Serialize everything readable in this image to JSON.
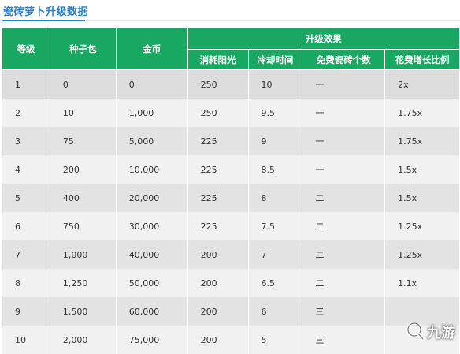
{
  "title": "瓷砖萝卜升级数据",
  "headers": {
    "level": "等级",
    "seed_pack": "种子包",
    "gold": "金币",
    "upgrade_effect": "升级效果",
    "sun_cost": "消耗阳光",
    "cooldown": "冷却时间",
    "free_tiles": "免费瓷砖个数",
    "cost_growth": "花费增长比例"
  },
  "rows": [
    {
      "level": "1",
      "seed_pack": "0",
      "gold": "0",
      "sun_cost": "250",
      "cooldown": "10",
      "free_tiles": "一",
      "cost_growth": "2x"
    },
    {
      "level": "2",
      "seed_pack": "10",
      "gold": "1,000",
      "sun_cost": "250",
      "cooldown": "9.5",
      "free_tiles": "一",
      "cost_growth": "1.75x"
    },
    {
      "level": "3",
      "seed_pack": "75",
      "gold": "5,000",
      "sun_cost": "225",
      "cooldown": "9",
      "free_tiles": "一",
      "cost_growth": "1.75x"
    },
    {
      "level": "4",
      "seed_pack": "200",
      "gold": "10,000",
      "sun_cost": "225",
      "cooldown": "8.5",
      "free_tiles": "一",
      "cost_growth": "1.5x"
    },
    {
      "level": "5",
      "seed_pack": "400",
      "gold": "20,000",
      "sun_cost": "225",
      "cooldown": "8",
      "free_tiles": "二",
      "cost_growth": "1.5x"
    },
    {
      "level": "6",
      "seed_pack": "750",
      "gold": "30,000",
      "sun_cost": "225",
      "cooldown": "7.5",
      "free_tiles": "二",
      "cost_growth": "1.25x"
    },
    {
      "level": "7",
      "seed_pack": "1,000",
      "gold": "40,000",
      "sun_cost": "200",
      "cooldown": "7",
      "free_tiles": "二",
      "cost_growth": "1.25x"
    },
    {
      "level": "8",
      "seed_pack": "1,250",
      "gold": "50,000",
      "sun_cost": "200",
      "cooldown": "6.5",
      "free_tiles": "二",
      "cost_growth": "1.1x"
    },
    {
      "level": "9",
      "seed_pack": "1,500",
      "gold": "60,000",
      "sun_cost": "200",
      "cooldown": "6",
      "free_tiles": "三",
      "cost_growth": ""
    },
    {
      "level": "10",
      "seed_pack": "2,000",
      "gold": "75,000",
      "sun_cost": "200",
      "cooldown": "5",
      "free_tiles": "三",
      "cost_growth": ""
    }
  ],
  "watermark": "九游",
  "colors": {
    "header_bg": "#18a862",
    "title": "#2a7fd0"
  }
}
